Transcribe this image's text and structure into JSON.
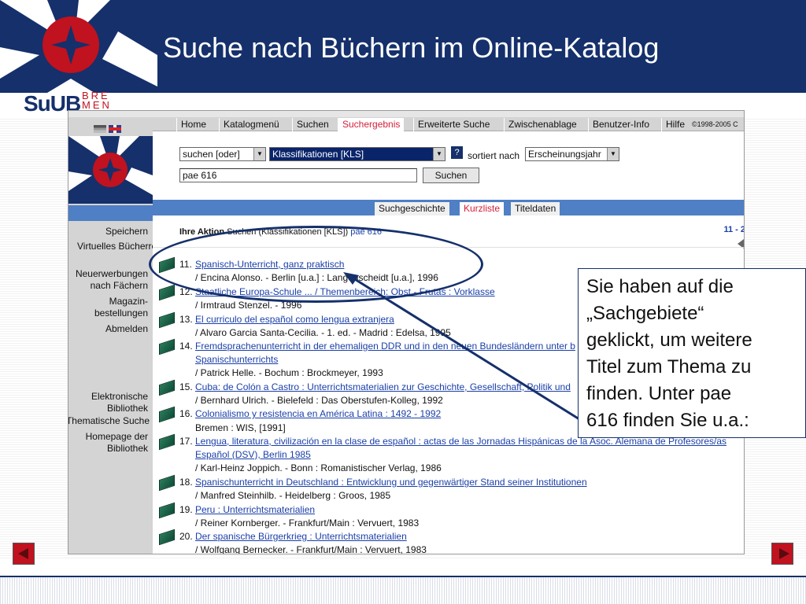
{
  "slide": {
    "title": "Suche nach Büchern im Online-Katalog",
    "brand": "SuUB",
    "brand_suffix": "BRE MEN"
  },
  "nav": {
    "items": [
      "Home",
      "Katalogmenü",
      "Suchen",
      "Suchergebnis",
      "Erweiterte Suche",
      "Zwischenablage",
      "Benutzer-Info",
      "Hilfe"
    ],
    "active": "Suchergebnis",
    "copyright": "©1998-2005 C"
  },
  "search": {
    "mode": "suchen [oder]",
    "index": "Klassifikationen [KLS]",
    "help": "?",
    "sort_label": "sortiert nach",
    "sort_value": "Erscheinungsjahr",
    "query": "pae 616",
    "submit": "Suchen"
  },
  "tabs": [
    "Suchgeschichte",
    "Kurzliste",
    "Titeldaten"
  ],
  "active_tab": "Kurzliste",
  "sidebar": {
    "links": [
      "Speichern",
      "Virtuelles Bücherregal",
      "Neuerwerbungen nach Fächern",
      "Magazin-bestellungen",
      "Abmelden",
      "Elektronische Bibliothek",
      "Thematische Suche",
      "Homepage der Bibliothek"
    ]
  },
  "results": {
    "action_label": "Ihre Aktion",
    "action_text": "Suchen (Klassifikationen [KLS])",
    "action_query": "pae 616",
    "pager": "11 - 2",
    "records": [
      {
        "num": "11.",
        "title": "Spanisch-Unterricht, ganz praktisch",
        "meta": "/ Encina Alonso. - Berlin [u.a.] : Langenscheidt [u.a.], 1996"
      },
      {
        "num": "12.",
        "title": "Staatliche Europa-Schule ... / Themenbereich: Obst - Frutas : Vorklasse",
        "meta": "/ Irmtraud Stenzel. - 1996"
      },
      {
        "num": "13.",
        "title": "El curriculo del español como lengua extranjera",
        "meta": "/ Alvaro Garcia Santa-Cecilia. - 1. ed. - Madrid : Edelsa, 1995"
      },
      {
        "num": "14.",
        "title": "Fremdsprachenunterricht in der ehemaligen DDR und in den neuen Bundesländern unter b",
        "title2": "Spanischunterrichts",
        "meta": "/ Patrick Helle. - Bochum : Brockmeyer, 1993"
      },
      {
        "num": "15.",
        "title": "Cuba: de Colón a Castro : Unterrichtsmaterialien zur Geschichte, Gesellschaft, Politik und",
        "meta": "/ Bernhard Ulrich. - Bielefeld : Das Oberstufen-Kolleg, 1992"
      },
      {
        "num": "16.",
        "title": "Colonialismo y resistencia en América Latina : 1492 - 1992",
        "meta": "Bremen : WIS, [1991]"
      },
      {
        "num": "17.",
        "title": "Lengua, literatura, civilización en la clase de español : actas de las Jornadas Hispánicas de la Asoc. Alemana de Profesores/as",
        "title2": "Español (DSV), Berlin 1985",
        "meta": "/ Karl-Heinz Joppich. - Bonn : Romanistischer Verlag, 1986"
      },
      {
        "num": "18.",
        "title": "Spanischunterricht in Deutschland : Entwicklung und gegenwärtiger Stand seiner Institutionen",
        "meta": "/ Manfred Steinhilb. - Heidelberg : Groos, 1985"
      },
      {
        "num": "19.",
        "title": "Peru : Unterrichtsmaterialien",
        "meta": "/ Reiner Kornberger. - Frankfurt/Main : Vervuert, 1983"
      },
      {
        "num": "20.",
        "title": "Der spanische Bürgerkrieg : Unterrichtsmaterialien",
        "meta": "/ Wolfgang Bernecker. - Frankfurt/Main : Vervuert, 1983"
      }
    ]
  },
  "callout": {
    "lines": [
      "Sie haben auf die",
      "„Sachgebiete“",
      "geklickt, um weitere",
      "Titel zum Thema zu",
      "finden. Unter pae",
      "616  finden Sie u.a.:"
    ]
  },
  "colors": {
    "header": "#15306b",
    "accent_red": "#c1121f",
    "link": "#1a3fa8",
    "band": "#4f7fc4"
  },
  "icons": {
    "prev": "arrow-left-icon",
    "next": "arrow-right-icon",
    "record": "book-icon"
  }
}
